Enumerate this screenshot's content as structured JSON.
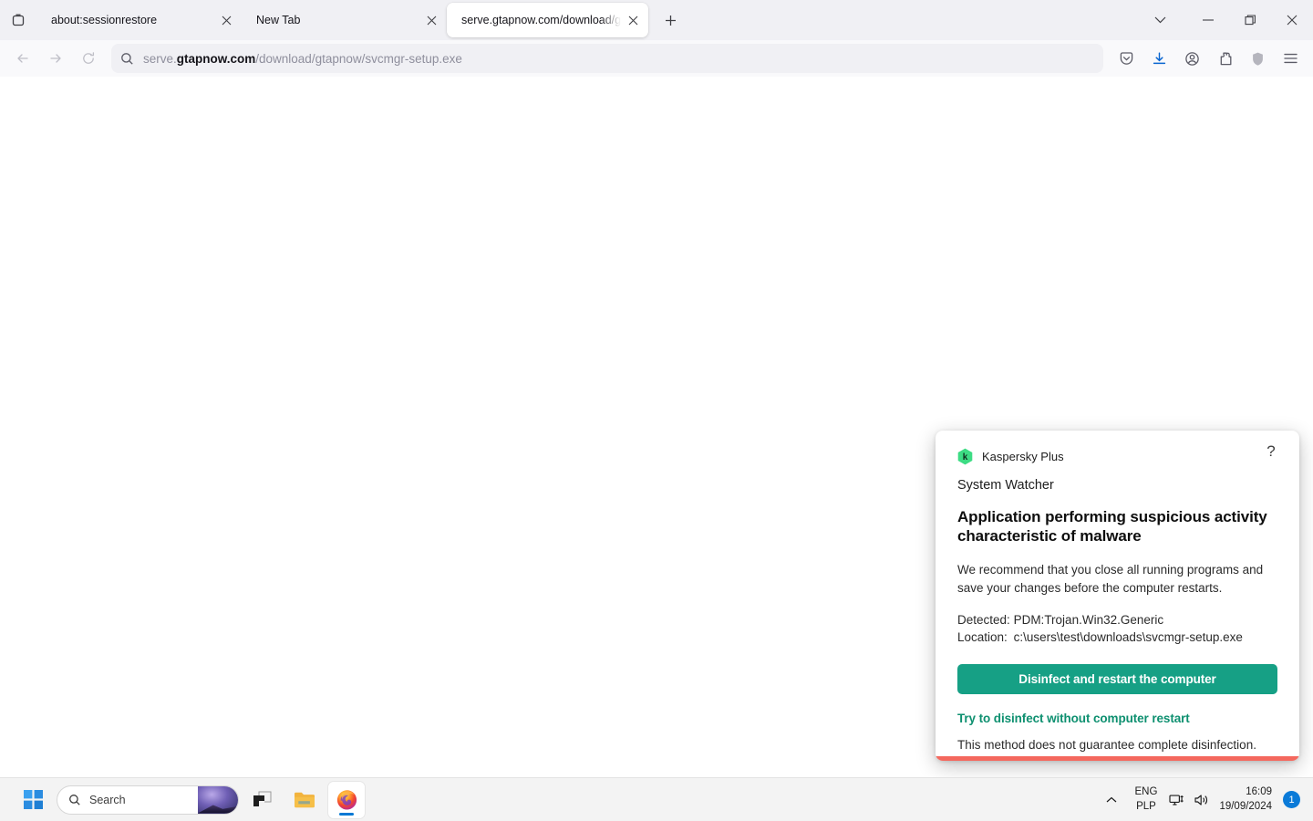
{
  "browser": {
    "tab_list_icon": "tab-list-icon",
    "tabs": [
      {
        "title": "about:sessionrestore",
        "active": false,
        "close_icon": "close-icon"
      },
      {
        "title": "New Tab",
        "active": false,
        "close_icon": "close-icon"
      },
      {
        "title": "serve.gtapnow.com/download/gtapnow/svcmgr-setup.exe",
        "active": true,
        "close_icon": "close-icon"
      }
    ],
    "new_tab_label": "+",
    "window_controls": {
      "list_all_tabs": "chevron-down-icon",
      "minimize": "minimize-icon",
      "maximize": "maximize-icon",
      "close": "close-icon"
    },
    "nav": {
      "back": "back-arrow-icon",
      "forward": "forward-arrow-icon",
      "reload": "reload-icon"
    },
    "urlbar": {
      "search_icon": "search-icon",
      "url_prefix": "serve.",
      "url_domain": "gtapnow.com",
      "url_path": "/download/gtapnow/svcmgr-setup.exe",
      "full_url": "serve.gtapnow.com/download/gtapnow/svcmgr-setup.exe"
    },
    "toolbar_icons": [
      "save-to-pocket-icon",
      "downloads-icon",
      "account-icon",
      "extensions-icon",
      "shield-icon",
      "application-menu-icon"
    ]
  },
  "dialog": {
    "brand": "Kaspersky Plus",
    "logo_icon": "kaspersky-logo-icon",
    "help_icon": "?",
    "module": "System Watcher",
    "title": "Application performing suspicious activity characteristic of malware",
    "advice": "We recommend that you close all running programs and save your changes before the computer restarts.",
    "detected_label": "Detected:",
    "detected_value": "PDM:Trojan.Win32.Generic",
    "location_label": "Location:",
    "location_value": "c:\\users\\test\\downloads\\svcmgr-setup.exe",
    "primary_button": "Disinfect and restart the computer",
    "secondary_link": "Try to disinfect without computer restart",
    "note": "This method does not guarantee complete disinfection.",
    "accent_color": "#f4685e",
    "button_color": "#16a085",
    "link_color": "#0e9070"
  },
  "taskbar": {
    "start_icon": "windows-start-icon",
    "search_icon": "search-icon",
    "search_placeholder": "Search",
    "apps": [
      {
        "name": "task-view",
        "active": false
      },
      {
        "name": "file-explorer",
        "active": false
      },
      {
        "name": "firefox",
        "active": true
      }
    ],
    "tray": {
      "chevron_icon": "chevron-up-icon",
      "language_line1": "ENG",
      "language_line2": "PLP",
      "network_icon": "network-icon",
      "volume_icon": "volume-icon",
      "time": "16:09",
      "date": "19/09/2024",
      "notification_count": "1"
    }
  }
}
